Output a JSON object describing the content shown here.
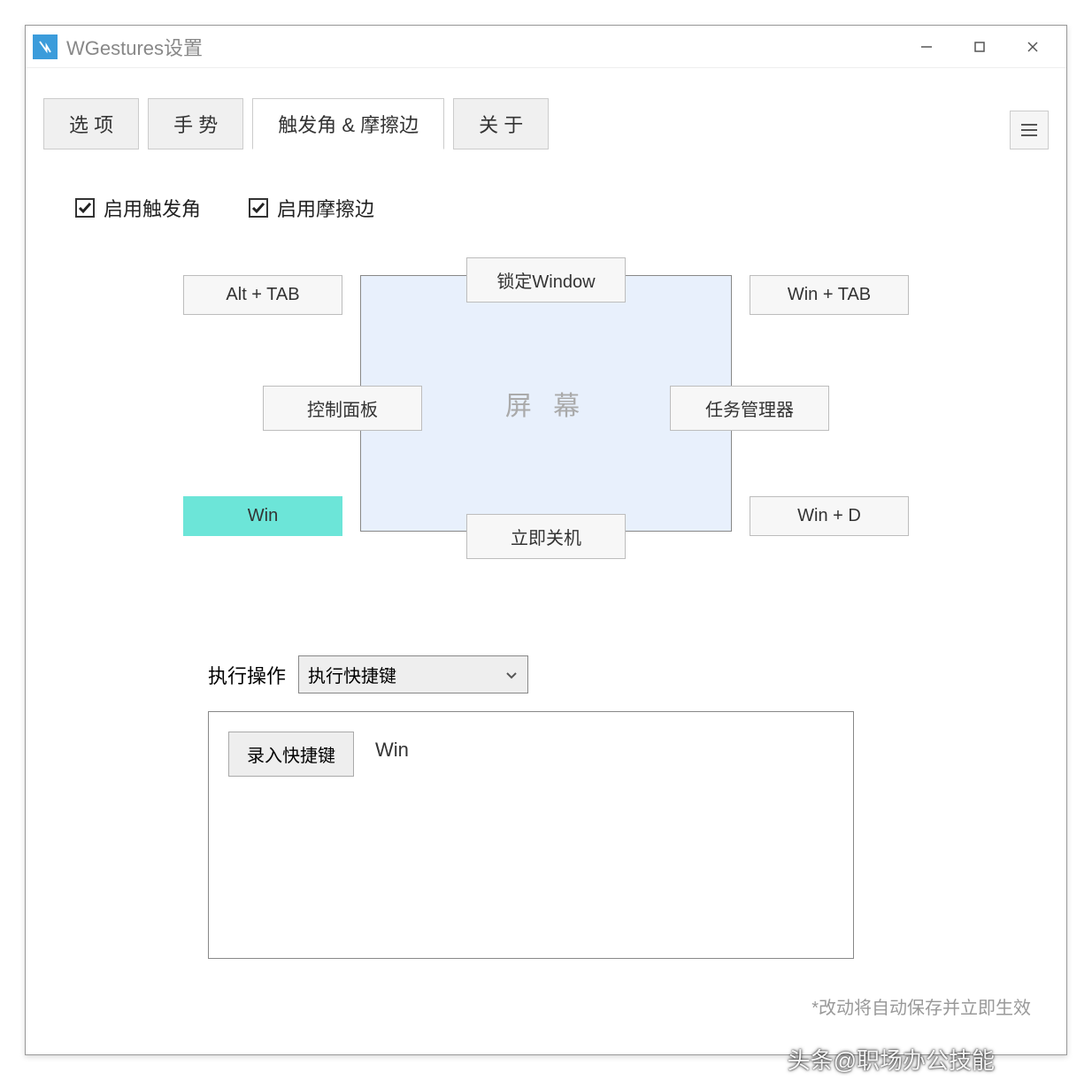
{
  "window": {
    "title": "WGestures设置"
  },
  "tabs": {
    "options": "选 项",
    "gestures": "手 势",
    "hotcorners": "触发角 & 摩擦边",
    "about": "关 于"
  },
  "checkboxes": {
    "enable_corners": "启用触发角",
    "enable_edges": "启用摩擦边"
  },
  "screen": {
    "label": "屏 幕",
    "top_left": "Alt + TAB",
    "top_edge": "锁定Window",
    "top_right": "Win + TAB",
    "mid_left": "控制面板",
    "mid_right": "任务管理器",
    "bottom_left": "Win",
    "bottom_edge": "立即关机",
    "bottom_right": "Win + D"
  },
  "operation": {
    "label": "执行操作",
    "selected": "执行快捷键"
  },
  "hotkey": {
    "record_button": "录入快捷键",
    "value": "Win"
  },
  "footnote": "*改动将自动保存并立即生效",
  "watermark": "头条@职场办公技能"
}
